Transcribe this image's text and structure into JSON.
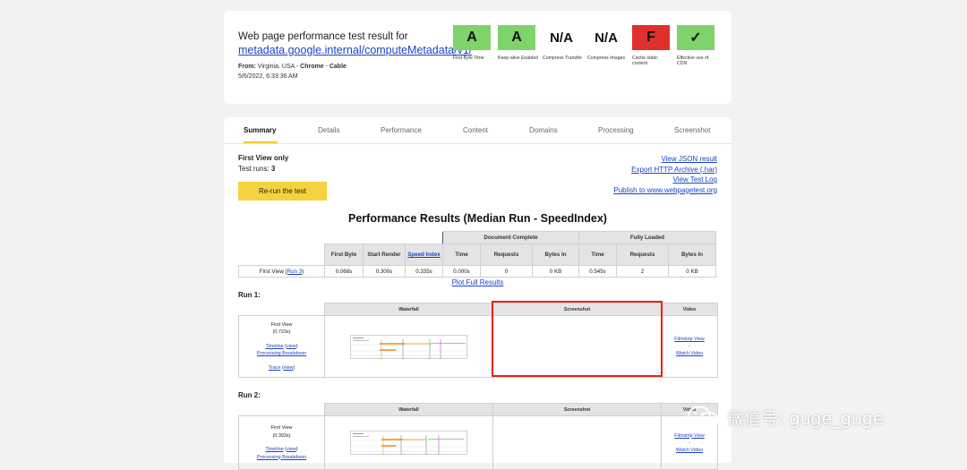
{
  "header": {
    "title": "Web page performance test result for",
    "url": "metadata.google.internal/computeMetadata/v1/",
    "from_label": "From:",
    "location": "Virginia, USA",
    "browser": "Chrome",
    "connection": "Cable",
    "date": "5/6/2022, 6:33:36 AM",
    "grades": [
      {
        "grade": "A",
        "label": "First Byte Time",
        "color": "#7ed36a"
      },
      {
        "grade": "A",
        "label": "Keep-alive Enabled",
        "color": "#7ed36a"
      },
      {
        "grade": "N/A",
        "label": "Compress Transfer",
        "color": "none"
      },
      {
        "grade": "N/A",
        "label": "Compress Images",
        "color": "none"
      },
      {
        "grade": "F",
        "label": "Cache static content",
        "color": "#e0302e"
      },
      {
        "grade": "✓",
        "label": "Effective use of CDN",
        "color": "#7ed36a"
      }
    ]
  },
  "tabs": [
    "Summary",
    "Details",
    "Performance",
    "Content",
    "Domains",
    "Processing",
    "Screenshot"
  ],
  "active_tab": "Summary",
  "summary": {
    "first_view_only": "First View only",
    "test_runs_label": "Test runs:",
    "test_runs_value": "3",
    "rerun_label": "Re-run the test",
    "links": [
      "View JSON result",
      "Export HTTP Archive (.har)",
      "View Test Log",
      "Publish to www.webpagetest.org"
    ]
  },
  "perf": {
    "title": "Performance Results (Median Run - SpeedIndex)",
    "group_document": "Document Complete",
    "group_fully": "Fully Loaded",
    "col_first_byte": "First Byte",
    "col_start_render": "Start Render",
    "col_speed_index": "Speed Index",
    "col_time": "Time",
    "col_requests": "Requests",
    "col_bytes_in": "Bytes In",
    "row_label_prefix": "First View (",
    "row_label_link": "Run 3",
    "row_label_suffix": ")",
    "first_byte": "0.068s",
    "start_render": "0.300s",
    "speed_index": "0.335s",
    "doc_time": "0.000s",
    "doc_requests": "0",
    "doc_bytes": "0 KB",
    "full_time": "0.545s",
    "full_requests": "2",
    "full_bytes": "0 KB",
    "plot_link": "Plot Full Results"
  },
  "runs": [
    {
      "label": "Run 1:",
      "first_view": "First View",
      "duration": "(0.723s)",
      "timeline": "Timeline",
      "view": "view",
      "processing": "Processing Breakdown",
      "trace": "Trace",
      "col_waterfall": "Waterfall",
      "col_screenshot": "Screenshot",
      "col_video": "Video",
      "filmstrip": "Filmstrip View",
      "dash": "-",
      "watch_video": "Watch Video"
    },
    {
      "label": "Run 2:",
      "first_view": "First View",
      "duration": "(0.393s)",
      "timeline": "Timeline",
      "view": "view",
      "processing": "Processing Breakdown",
      "col_waterfall": "Waterfall",
      "col_screenshot": "Screenshot",
      "col_video": "Video",
      "filmstrip": "Filmstrip View",
      "dash": "-",
      "watch_video": "Watch Video"
    }
  ],
  "watermark": {
    "text": "微信号: guge_guge",
    "icon": "wechat-icon"
  },
  "colors": {
    "accent_yellow": "#f5d33e",
    "link_blue": "#1a44c8",
    "highlight_red": "#e8221b"
  }
}
